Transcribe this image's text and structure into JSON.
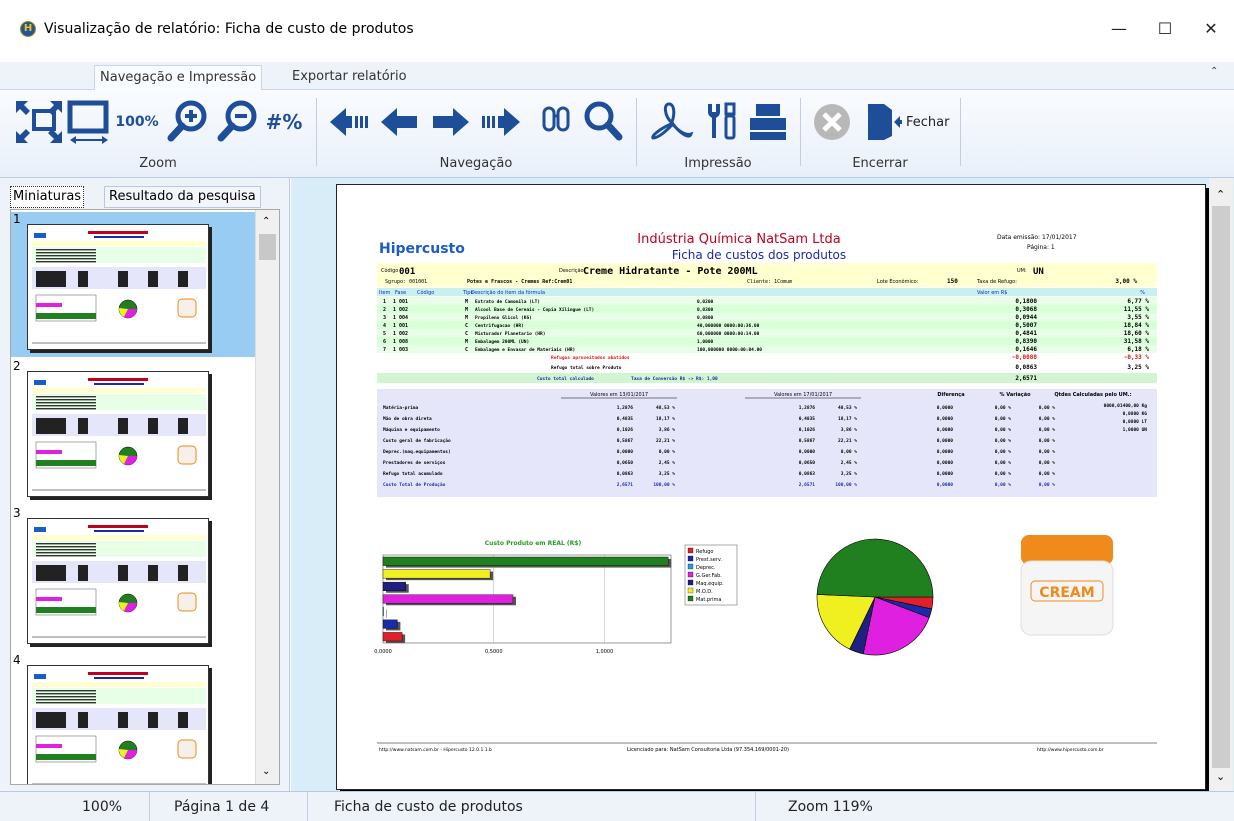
{
  "window": {
    "title": "Visualização de relatório: Ficha de custo de produtos",
    "app_icon": "H",
    "minimize": "—",
    "maximize": "☐",
    "close": "✕"
  },
  "ribbon_tabs": [
    "Navegação e Impressão",
    "Exportar relatório"
  ],
  "ribbon": {
    "zoom_pct_label": "100%",
    "page_num_label": "#%",
    "groups": {
      "zoom": "Zoom",
      "nav": "Navegação",
      "print": "Impressão",
      "close": "Encerrar"
    },
    "close_button": "Fechar",
    "icons": [
      "fit-page-icon",
      "page-width-icon",
      "zoom-100-icon",
      "zoom-in-icon",
      "zoom-out-icon",
      "zoom-percent-icon",
      "first-page-icon",
      "prev-page-icon",
      "next-page-icon",
      "last-page-icon",
      "find-icon",
      "search-icon",
      "pdf-icon",
      "printer-settings-icon",
      "printer-icon",
      "cancel-icon",
      "exit-door-icon"
    ]
  },
  "left_tabs": [
    "Miniaturas",
    "Resultado da pesquisa"
  ],
  "thumbnails": [
    "1",
    "2",
    "3",
    "4"
  ],
  "status": {
    "zoom": "100%",
    "page": "Página 1 de 4",
    "report": "Ficha de custo de produtos",
    "zoom2": "Zoom 119%"
  },
  "report": {
    "logo": "Hipercusto",
    "company": "Indústria Química NatSam Ltda",
    "subtitle": "Ficha de custos dos produtos",
    "emission": "Data emissão: 17/01/2017",
    "page": "Página: 1",
    "code_label": "Código",
    "code": "001",
    "desc_label": "Descrição",
    "desc": "Creme Hidratante - Pote 200ML",
    "um_label": "UM:",
    "um": "UN",
    "subgroup": "Sgrupo: 001001",
    "group_line": "Potes e Frascos - Cremes  Ref:Crem01",
    "client": "Cliente: 1Comum",
    "lote_label": "Lote Econômico:",
    "lote": "150",
    "refugo_label": "Taxa de Refugo:",
    "refugo": "3,00 %",
    "columns": [
      "Item",
      "Fase",
      "Código",
      "Tipo",
      "Descrição do item da fórmula",
      "Valor em R$",
      "%"
    ],
    "items": [
      {
        "item": "1",
        "fase": "1 001",
        "tipo": "M",
        "desc": "Extrato de Camomila (LT)",
        "qty": "0,0200",
        "valor": "0,1800",
        "pct": "6,77 %"
      },
      {
        "item": "2",
        "fase": "1 002",
        "tipo": "M",
        "desc": "Alcool Base de Cereais - Copia Xilingue (LT)",
        "qty": "0,0300",
        "valor": "0,3068",
        "pct": "11,55 %"
      },
      {
        "item": "3",
        "fase": "1 004",
        "tipo": "M",
        "desc": "Propileno Glicol (KG)",
        "qty": "0,0800",
        "valor": "0,0944",
        "pct": "3,55 %"
      },
      {
        "item": "4",
        "fase": "1 001",
        "tipo": "C",
        "desc": "Centrifugacao (HR)",
        "qty": "40,000000 0000:00:36.00",
        "valor": "0,5007",
        "pct": "18,84 %"
      },
      {
        "item": "5",
        "fase": "1 002",
        "tipo": "C",
        "desc": "Misturador Planetario (HR)",
        "qty": "60,000000 0000:00:14.00",
        "valor": "0,4841",
        "pct": "18,60 %"
      },
      {
        "item": "6",
        "fase": "1 008",
        "tipo": "M",
        "desc": "Embalagem 200ML (UN)",
        "qty": "1,0000",
        "valor": "0,8390",
        "pct": "31,58 %"
      },
      {
        "item": "7",
        "fase": "1 003",
        "tipo": "C",
        "desc": "Embalagem e Envasar de Materiais (HR)",
        "qty": "100,000000 0000:00:04.00",
        "valor": "0,1646",
        "pct": "6,18 %"
      }
    ],
    "credit_label": "Refugos aproveitados abatidos",
    "credit_val": "-0,0088",
    "credit_pct": "-0,33 %",
    "refugo_total_label": "Refugo total sobre Produto",
    "refugo_total_val": "0,0863",
    "refugo_total_pct": "3,25 %",
    "custo_label": "Custo total calculado",
    "taxa_conv": "Taxa de Conversão R$ -> R$:  1,00",
    "custo_val": "2,6571",
    "comp_headers": [
      "Valores em 13/01/2017",
      "Valores em 17/01/2017",
      "Diferença",
      "% Variação",
      "Qtdes Calculadas pelo UM.:"
    ],
    "comp_rows": [
      {
        "label": "Matéria-prima",
        "v1": "1,2876",
        "p1": "48,53 %",
        "v2": "1,2876",
        "p2": "48,53 %",
        "dif": "0,0000",
        "var": "0,00 %"
      },
      {
        "label": "Mão de obra direta",
        "v1": "0,4835",
        "p1": "18,17 %",
        "v2": "0,4835",
        "p2": "18,17 %",
        "dif": "0,0000",
        "var": "0,00 %"
      },
      {
        "label": "Máquina e equipamento",
        "v1": "0,1026",
        "p1": "3,86 %",
        "v2": "0,1026",
        "p2": "3,86 %",
        "dif": "0,0000",
        "var": "0,00 %"
      },
      {
        "label": "Custo geral de fabricação",
        "v1": "0,5867",
        "p1": "22,21 %",
        "v2": "0,5867",
        "p2": "22,21 %",
        "dif": "0,0000",
        "var": "0,00 %"
      },
      {
        "label": "Deprec.(maq.equipamentos)",
        "v1": "0,0000",
        "p1": "0,00 %",
        "v2": "0,0000",
        "p2": "0,00 %",
        "dif": "0,0000",
        "var": "0,00 %"
      },
      {
        "label": "Prestadores de serviços",
        "v1": "0,0650",
        "p1": "2,45 %",
        "v2": "0,0650",
        "p2": "2,45 %",
        "dif": "0,0000",
        "var": "0,00 %"
      },
      {
        "label": "Refugo total acumulado",
        "v1": "0,0863",
        "p1": "3,25 %",
        "v2": "0,0863",
        "p2": "3,25 %",
        "dif": "0,0000",
        "var": "0,00 %"
      },
      {
        "label": "Custo Total de Produção",
        "v1": "2,6571",
        "p1": "100,00 %",
        "v2": "2,6571",
        "p2": "100,00 %",
        "dif": "0,0000",
        "var": "0,00 %"
      }
    ],
    "qtds": [
      "0000,01400,00 Kg",
      "0,0800 KG",
      "0,0800 LT",
      "1,0000 UN"
    ],
    "chart_title": "Custo Produto em REAL (R$)",
    "product_label": "CREAM",
    "footer_left": "http://www.natsam.com.br - Hipercusto 12.0.1.1.b",
    "footer_mid": "Licenciado para: NatSam Consultoria Ltda (97.354.169/0001-20)",
    "footer_right": "http://www.hipercusto.com.br"
  },
  "chart_data": [
    {
      "type": "bar",
      "title": "Custo Produto em REAL (R$)",
      "orientation": "horizontal",
      "categories": [
        "Refugo",
        "Prest.serv.",
        "Deprec.",
        "G.Ger.Fab.",
        "Maq.equip.",
        "M.O.D.",
        "Mat.prima"
      ],
      "values": [
        0.0863,
        0.065,
        0.0,
        0.5867,
        0.1026,
        0.4835,
        1.2876
      ],
      "colors": [
        "#e0202a",
        "#1a2aa8",
        "#1ea0e0",
        "#e020e0",
        "#202080",
        "#f0f020",
        "#208020"
      ],
      "xlim": [
        0,
        1.3
      ],
      "xticks": [
        "0,0000",
        "0,5000",
        "1,0000"
      ]
    },
    {
      "type": "pie",
      "labels": [
        "Refugo",
        "Prest.serv.",
        "Deprec.",
        "G.Ger.Fab.",
        "Maq.equip.",
        "M.O.D.",
        "Mat.prima"
      ],
      "values": [
        0.0863,
        0.065,
        0.0,
        0.5867,
        0.1026,
        0.4835,
        1.2876
      ],
      "colors": [
        "#e0202a",
        "#1a2aa8",
        "#1ea0e0",
        "#e020e0",
        "#202080",
        "#f0f020",
        "#208020"
      ]
    }
  ]
}
